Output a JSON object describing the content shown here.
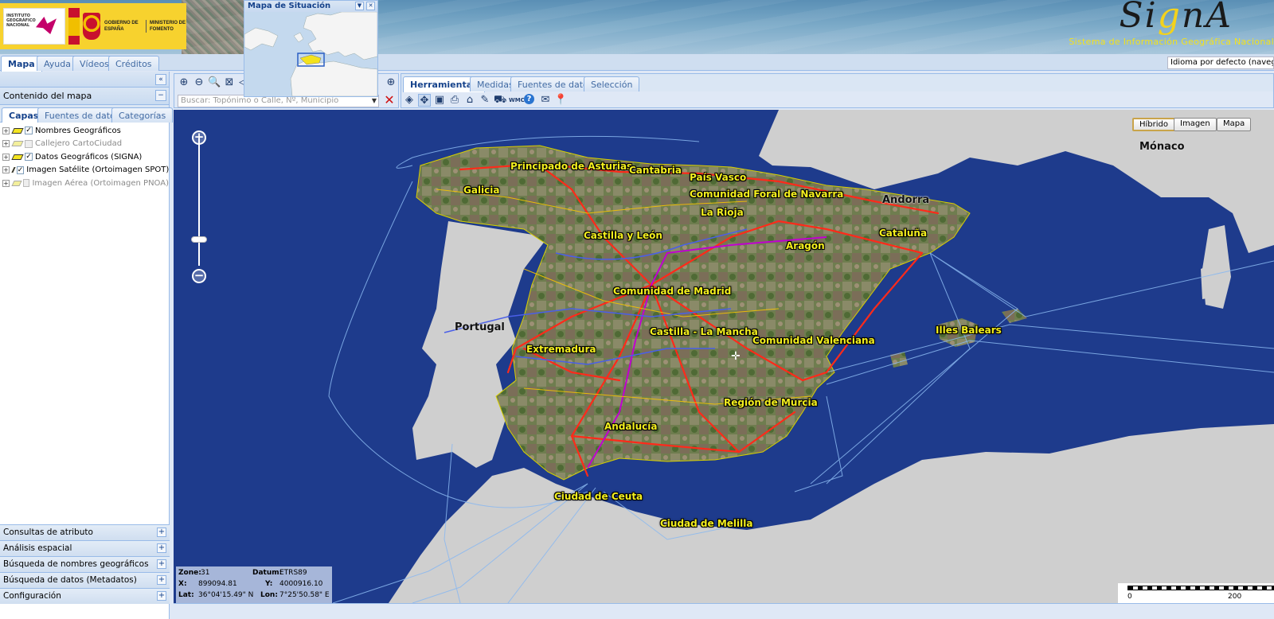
{
  "header": {
    "ign_text": "INSTITUTO GEOGRÁFICO NACIONAL",
    "gobierno_text": "GOBIERNO DE ESPAÑA",
    "ministerio_text": "MINISTERIO DE FOMENTO",
    "app_title": "SignA",
    "app_subtitle": "Sistema de Información Geográfica Nacional"
  },
  "top_tabs": [
    {
      "label": "Mapa",
      "active": true
    },
    {
      "label": "Ayuda",
      "active": false
    },
    {
      "label": "Vídeos",
      "active": false
    },
    {
      "label": "Créditos",
      "active": false
    }
  ],
  "language_select": {
    "value": "Idioma por defecto (navegador)"
  },
  "situation_map": {
    "title": "Mapa de Situación"
  },
  "left_panel": {
    "title": "Contenido del mapa",
    "tabs": [
      {
        "label": "Capas",
        "active": true
      },
      {
        "label": "Fuentes de datos",
        "active": false
      },
      {
        "label": "Categorías",
        "active": false
      }
    ],
    "layers": [
      {
        "label": "Nombres Geográficos",
        "checked": true,
        "enabled": true
      },
      {
        "label": "Callejero CartoCiudad",
        "checked": false,
        "enabled": false
      },
      {
        "label": "Datos Geográficos (SIGNA)",
        "checked": true,
        "enabled": true
      },
      {
        "label": "Imagen Satélite (Ortoimagen SPOT)",
        "checked": true,
        "enabled": true
      },
      {
        "label": "Imagen Aérea (Ortoimagen PNOA)",
        "checked": false,
        "enabled": false
      }
    ],
    "accordion": [
      "Consultas de atributo",
      "Análisis espacial",
      "Búsqueda de nombres geográficos",
      "Búsqueda de datos (Metadatos)",
      "Configuración"
    ]
  },
  "search": {
    "placeholder": "Buscar: Topónimo o Calle, Nº, Municipio"
  },
  "tool_tabs": [
    {
      "label": "Herramientas",
      "active": true
    },
    {
      "label": "Medidas",
      "active": false
    },
    {
      "label": "Fuentes de datos",
      "active": false
    },
    {
      "label": "Selección",
      "active": false
    }
  ],
  "map_buttons": [
    {
      "label": "Híbrido",
      "selected": true
    },
    {
      "label": "Imagen",
      "selected": false
    },
    {
      "label": "Mapa",
      "selected": false
    }
  ],
  "places": {
    "asturias": "Principado de Asturias",
    "cantabria": "Cantabria",
    "paisvasco": "País Vasco",
    "navarra": "Comunidad Foral de Navarra",
    "galicia": "Galicia",
    "rioja": "La Rioja",
    "andorra": "Andorra",
    "monaco": "Mónaco",
    "castillaleon": "Castilla y León",
    "cataluna": "Cataluña",
    "aragon": "Aragón",
    "madrid": "Comunidad de Madrid",
    "portugal": "Portugal",
    "castillamancha": "Castilla - La Mancha",
    "baleares": "Illes Balears",
    "valenciana": "Comunidad Valenciana",
    "extremadura": "Extremadura",
    "murcia": "Región de Murcia",
    "andalucia": "Andalucía",
    "ceuta": "Ciudad de Ceuta",
    "melilla": "Ciudad de Melilla"
  },
  "coords": {
    "zone_label": "Zone:",
    "zone_value": "31",
    "datum_label": "Datum:",
    "datum_value": "ETRS89",
    "x_label": "X:",
    "x_value": "899094.81",
    "y_label": "Y:",
    "y_value": "4000916.10",
    "lat_label": "Lat:",
    "lat_value": "36°04'15.49\"  N",
    "lon_label": "Lon:",
    "lon_value": "7°25'50.58\"  E"
  },
  "scalebar": {
    "start": "0",
    "mid": "200"
  },
  "colors": {
    "accent": "#15428b",
    "sea": "#1e3b8c",
    "label": "#f3ef1e",
    "roads": "#ff2a1a"
  }
}
